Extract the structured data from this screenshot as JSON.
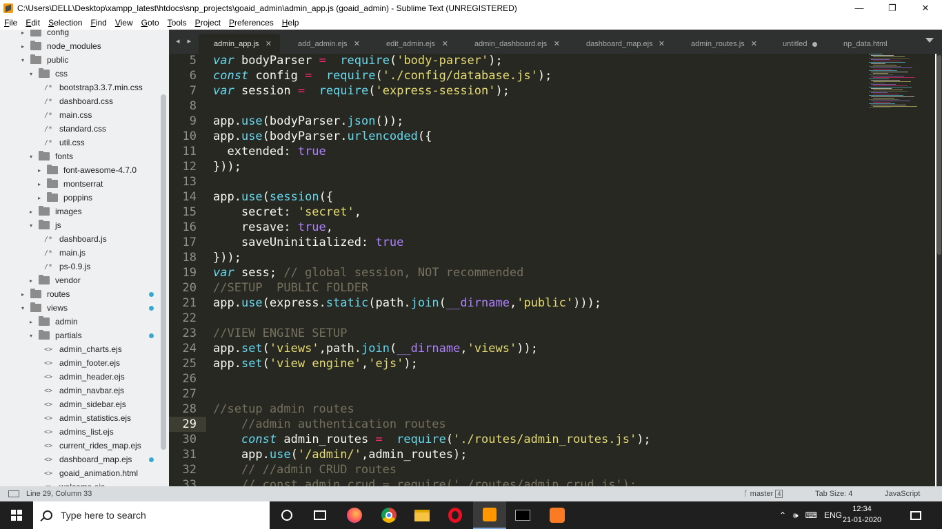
{
  "window": {
    "title": "C:\\Users\\DELL\\Desktop\\xampp_latest\\htdocs\\snp_projects\\goaid_admin\\admin_app.js (goaid_admin) - Sublime Text (UNREGISTERED)",
    "minimize": "—",
    "maximize": "❐",
    "close": "✕"
  },
  "menu": [
    "File",
    "Edit",
    "Selection",
    "Find",
    "View",
    "Goto",
    "Tools",
    "Project",
    "Preferences",
    "Help"
  ],
  "sidebar": {
    "items": [
      {
        "label": "config",
        "type": "folder",
        "arrow": "▸"
      },
      {
        "label": "node_modules",
        "type": "folder",
        "arrow": "▸"
      },
      {
        "label": "public",
        "type": "folder",
        "arrow": "▾"
      },
      {
        "label": "css",
        "type": "folder",
        "arrow": "▾"
      },
      {
        "label": "bootstrap3.3.7.min.css",
        "type": "file",
        "mark": "/*"
      },
      {
        "label": "dashboard.css",
        "type": "file",
        "mark": "/*"
      },
      {
        "label": "main.css",
        "type": "file",
        "mark": "/*"
      },
      {
        "label": "standard.css",
        "type": "file",
        "mark": "/*"
      },
      {
        "label": "util.css",
        "type": "file",
        "mark": "/*"
      },
      {
        "label": "fonts",
        "type": "folder",
        "arrow": "▾"
      },
      {
        "label": "font-awesome-4.7.0",
        "type": "folder",
        "arrow": "▸"
      },
      {
        "label": "montserrat",
        "type": "folder",
        "arrow": "▸"
      },
      {
        "label": "poppins",
        "type": "folder",
        "arrow": "▸"
      },
      {
        "label": "images",
        "type": "folder",
        "arrow": "▸"
      },
      {
        "label": "js",
        "type": "folder",
        "arrow": "▾"
      },
      {
        "label": "dashboard.js",
        "type": "file",
        "mark": "/*"
      },
      {
        "label": "main.js",
        "type": "file",
        "mark": "/*"
      },
      {
        "label": "ps-0.9.js",
        "type": "file",
        "mark": "/*"
      },
      {
        "label": "vendor",
        "type": "folder",
        "arrow": "▸"
      },
      {
        "label": "routes",
        "type": "folder",
        "arrow": "▸",
        "modified": true
      },
      {
        "label": "views",
        "type": "folder",
        "arrow": "▾",
        "modified": true
      },
      {
        "label": "admin",
        "type": "folder",
        "arrow": "▸"
      },
      {
        "label": "partials",
        "type": "folder",
        "arrow": "▾",
        "modified": true
      },
      {
        "label": "admin_charts.ejs",
        "type": "file",
        "mark": "<>"
      },
      {
        "label": "admin_footer.ejs",
        "type": "file",
        "mark": "<>"
      },
      {
        "label": "admin_header.ejs",
        "type": "file",
        "mark": "<>"
      },
      {
        "label": "admin_navbar.ejs",
        "type": "file",
        "mark": "<>"
      },
      {
        "label": "admin_sidebar.ejs",
        "type": "file",
        "mark": "<>"
      },
      {
        "label": "admin_statistics.ejs",
        "type": "file",
        "mark": "<>"
      },
      {
        "label": "admins_list.ejs",
        "type": "file",
        "mark": "<>"
      },
      {
        "label": "current_rides_map.ejs",
        "type": "file",
        "mark": "<>"
      },
      {
        "label": "dashboard_map.ejs",
        "type": "file",
        "mark": "<>",
        "modified": true
      },
      {
        "label": "goaid_animation.html",
        "type": "file",
        "mark": "<>"
      },
      {
        "label": "welcome.ejs",
        "type": "file",
        "mark": "<>"
      }
    ]
  },
  "tabs": [
    {
      "label": "admin_app.js",
      "active": true,
      "control": "✕"
    },
    {
      "label": "add_admin.ejs",
      "control": "✕"
    },
    {
      "label": "edit_admin.ejs",
      "control": "✕"
    },
    {
      "label": "admin_dashboard.ejs",
      "control": "✕"
    },
    {
      "label": "dashboard_map.ejs",
      "control": "✕"
    },
    {
      "label": "admin_routes.js",
      "control": "✕"
    },
    {
      "label": "untitled",
      "dirty": true
    },
    {
      "label": "np_data.html"
    }
  ],
  "tab_nav": "◂ ▸",
  "editor": {
    "current_line": 29,
    "lines": [
      {
        "n": "5",
        "tokens": [
          [
            "kw-s",
            "var"
          ],
          [
            "",
            "bodyParser "
          ],
          [
            "kw",
            "="
          ],
          [
            "",
            ""
          ],
          [
            "fn",
            " require"
          ],
          [
            "",
            "("
          ],
          [
            "str",
            "'body-parser'"
          ],
          [
            "",
            ");"
          ]
        ]
      },
      {
        "n": "6",
        "tokens": [
          [
            "kw-s",
            "const"
          ],
          [
            "",
            "config "
          ],
          [
            "kw",
            "="
          ],
          [
            "fn",
            " require"
          ],
          [
            "",
            "("
          ],
          [
            "str",
            "'./config/database.js'"
          ],
          [
            "",
            ");"
          ]
        ]
      },
      {
        "n": "7",
        "tokens": [
          [
            "kw-s",
            "var"
          ],
          [
            "",
            "session "
          ],
          [
            "kw",
            "="
          ],
          [
            "fn",
            " require"
          ],
          [
            "",
            "("
          ],
          [
            "str",
            "'express-session'"
          ],
          [
            "",
            ");"
          ]
        ]
      },
      {
        "n": "8",
        "tokens": []
      },
      {
        "n": "9",
        "tokens": [
          [
            "",
            "app."
          ],
          [
            "fn",
            "use"
          ],
          [
            "",
            "(bodyParser."
          ],
          [
            "fn",
            "json"
          ],
          [
            "",
            "());"
          ]
        ]
      },
      {
        "n": "10",
        "tokens": [
          [
            "",
            "app."
          ],
          [
            "fn",
            "use"
          ],
          [
            "",
            "(bodyParser."
          ],
          [
            "fn",
            "urlencoded"
          ],
          [
            "",
            "({"
          ]
        ]
      },
      {
        "n": "11",
        "tokens": [
          [
            "",
            "  extended: "
          ],
          [
            "cst",
            "true"
          ]
        ]
      },
      {
        "n": "12",
        "tokens": [
          [
            "",
            "}));"
          ]
        ]
      },
      {
        "n": "13",
        "tokens": []
      },
      {
        "n": "14",
        "tokens": [
          [
            "",
            "app."
          ],
          [
            "fn",
            "use"
          ],
          [
            "",
            "("
          ],
          [
            "fn",
            "session"
          ],
          [
            "",
            "({"
          ]
        ]
      },
      {
        "n": "15",
        "tokens": [
          [
            "",
            "    secret: "
          ],
          [
            "str",
            "'secret'"
          ],
          [
            "",
            ","
          ]
        ]
      },
      {
        "n": "16",
        "tokens": [
          [
            "",
            "    resave: "
          ],
          [
            "cst",
            "true"
          ],
          [
            "",
            ","
          ]
        ]
      },
      {
        "n": "17",
        "tokens": [
          [
            "",
            "    saveUninitialized: "
          ],
          [
            "cst",
            "true"
          ]
        ]
      },
      {
        "n": "18",
        "tokens": [
          [
            "",
            "}));"
          ]
        ]
      },
      {
        "n": "19",
        "tokens": [
          [
            "kw-s",
            "var"
          ],
          [
            "",
            "sess; "
          ],
          [
            "cmt",
            "// global session, NOT recommended"
          ]
        ]
      },
      {
        "n": "20",
        "tokens": [
          [
            "cmt",
            "//SETUP  PUBLIC FOLDER"
          ]
        ]
      },
      {
        "n": "21",
        "tokens": [
          [
            "",
            "app."
          ],
          [
            "fn",
            "use"
          ],
          [
            "",
            "(express."
          ],
          [
            "fn",
            "static"
          ],
          [
            "",
            "(path."
          ],
          [
            "fn",
            "join"
          ],
          [
            "",
            "("
          ],
          [
            "cst",
            "__dirname"
          ],
          [
            "",
            ","
          ],
          [
            "str",
            "'public'"
          ],
          [
            "",
            ")));"
          ]
        ]
      },
      {
        "n": "22",
        "tokens": []
      },
      {
        "n": "23",
        "tokens": [
          [
            "cmt",
            "//VIEW ENGINE SETUP"
          ]
        ]
      },
      {
        "n": "24",
        "tokens": [
          [
            "",
            "app."
          ],
          [
            "fn",
            "set"
          ],
          [
            "",
            "("
          ],
          [
            "str",
            "'views'"
          ],
          [
            "",
            ",path."
          ],
          [
            "fn",
            "join"
          ],
          [
            "",
            "("
          ],
          [
            "cst",
            "__dirname"
          ],
          [
            "",
            ","
          ],
          [
            "str",
            "'views'"
          ],
          [
            "",
            "));"
          ]
        ]
      },
      {
        "n": "25",
        "tokens": [
          [
            "",
            "app."
          ],
          [
            "fn",
            "set"
          ],
          [
            "",
            "("
          ],
          [
            "str",
            "'view engine'"
          ],
          [
            "",
            ","
          ],
          [
            "str",
            "'ejs'"
          ],
          [
            "",
            ");"
          ]
        ]
      },
      {
        "n": "26",
        "tokens": []
      },
      {
        "n": "27",
        "tokens": []
      },
      {
        "n": "28",
        "tokens": [
          [
            "cmt",
            "//setup admin routes"
          ]
        ]
      },
      {
        "n": "29",
        "tokens": [
          [
            "cmt",
            "    //admin authentication routes"
          ]
        ]
      },
      {
        "n": "30",
        "tokens": [
          [
            "kw-s",
            "    const"
          ],
          [
            "",
            "admin_routes "
          ],
          [
            "kw",
            "="
          ],
          [
            "fn",
            " require"
          ],
          [
            "",
            "("
          ],
          [
            "str",
            "'./routes/admin_routes.js'"
          ],
          [
            "",
            ");"
          ]
        ]
      },
      {
        "n": "31",
        "tokens": [
          [
            "",
            "    app."
          ],
          [
            "fn",
            "use"
          ],
          [
            "",
            "("
          ],
          [
            "str",
            "'/admin/'"
          ],
          [
            "",
            ",admin_routes);"
          ]
        ]
      },
      {
        "n": "32",
        "tokens": [
          [
            "cmt",
            "    // //admin CRUD routes"
          ]
        ]
      },
      {
        "n": "33",
        "tokens": [
          [
            "cmt",
            "    // const admin_crud = require('./routes/admin_crud.js');"
          ]
        ]
      }
    ]
  },
  "status": {
    "position": "Line 29, Column 33",
    "branch": "master",
    "branch_count": "4",
    "tab_size": "Tab Size: 4",
    "syntax": "JavaScript"
  },
  "taskbar": {
    "search_placeholder": "Type here to search",
    "language": "ENG",
    "time": "12:34",
    "date": "21-01-2020"
  }
}
